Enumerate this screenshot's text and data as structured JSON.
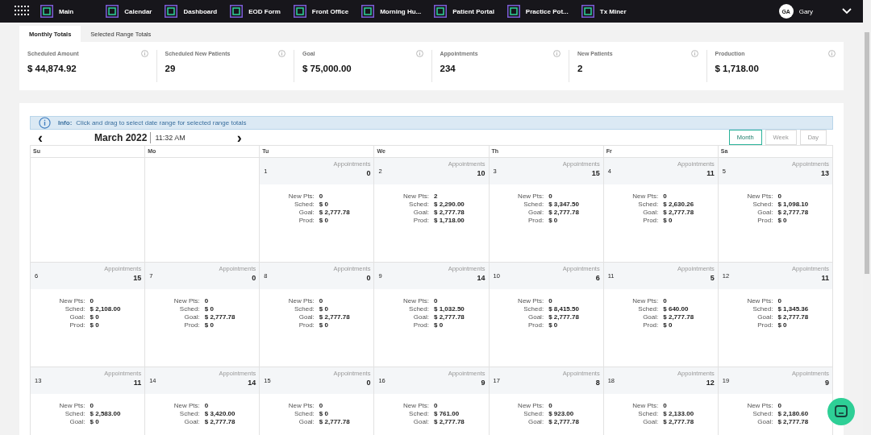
{
  "nav": {
    "items": [
      {
        "label": "Main"
      },
      {
        "label": "Calendar"
      },
      {
        "label": "Dashboard"
      },
      {
        "label": "EOD Form"
      },
      {
        "label": "Front Office"
      },
      {
        "label": "Morning Hu..."
      },
      {
        "label": "Patient Portal"
      },
      {
        "label": "Practice Pot..."
      },
      {
        "label": "Tx Miner"
      }
    ],
    "user": {
      "initials": "GA",
      "name": "Gary"
    }
  },
  "tabs": [
    {
      "label": "Monthly Totals",
      "selected": true
    },
    {
      "label": "Selected Range Totals",
      "selected": false
    }
  ],
  "stats": [
    {
      "label": "Scheduled Amount",
      "value": "$ 44,874.92"
    },
    {
      "label": "Scheduled New Patients",
      "value": "29"
    },
    {
      "label": "Goal",
      "value": "$ 75,000.00"
    },
    {
      "label": "Appointments",
      "value": "234"
    },
    {
      "label": "New Patients",
      "value": "2"
    },
    {
      "label": "Production",
      "value": "$ 1,718.00"
    }
  ],
  "info": {
    "label": "Info:",
    "text": "Click and drag to select date range for selected range totals"
  },
  "calendar": {
    "month": "March 2022",
    "time": "11:32 AM",
    "prev": "‹",
    "next": "›",
    "views": [
      {
        "label": "Month",
        "selected": true
      },
      {
        "label": "Week",
        "selected": false
      },
      {
        "label": "Day",
        "selected": false
      }
    ],
    "weekdays": [
      "Su",
      "Mo",
      "Tu",
      "We",
      "Th",
      "Fr",
      "Sa"
    ],
    "weeks": [
      [
        {
          "kind": "blank"
        },
        {
          "kind": "blank"
        },
        {
          "kind": "day",
          "day": "1",
          "appt_label": "Appointments",
          "appts": "0",
          "lines": [
            {
              "label": "New Pts:",
              "value": "0"
            },
            {
              "label": "Sched:",
              "value": "$ 0"
            },
            {
              "label": "Goal:",
              "value": "$ 2,777.78"
            },
            {
              "label": "Prod:",
              "value": "$ 0"
            }
          ]
        },
        {
          "kind": "day",
          "day": "2",
          "appt_label": "Appointments",
          "appts": "10",
          "lines": [
            {
              "label": "New Pts:",
              "value": "2"
            },
            {
              "label": "Sched:",
              "value": "$ 2,290.00"
            },
            {
              "label": "Goal:",
              "value": "$ 2,777.78"
            },
            {
              "label": "Prod:",
              "value": "$ 1,718.00"
            }
          ]
        },
        {
          "kind": "day",
          "day": "3",
          "appt_label": "Appointments",
          "appts": "15",
          "lines": [
            {
              "label": "New Pts:",
              "value": "0"
            },
            {
              "label": "Sched:",
              "value": "$ 3,347.50"
            },
            {
              "label": "Goal:",
              "value": "$ 2,777.78"
            },
            {
              "label": "Prod:",
              "value": "$ 0"
            }
          ]
        },
        {
          "kind": "day",
          "day": "4",
          "appt_label": "Appointments",
          "appts": "11",
          "lines": [
            {
              "label": "New Pts:",
              "value": "0"
            },
            {
              "label": "Sched:",
              "value": "$ 2,630.26"
            },
            {
              "label": "Goal:",
              "value": "$ 2,777.78"
            },
            {
              "label": "Prod:",
              "value": "$ 0"
            }
          ]
        },
        {
          "kind": "day",
          "day": "5",
          "appt_label": "Appointments",
          "appts": "13",
          "lines": [
            {
              "label": "New Pts:",
              "value": "0"
            },
            {
              "label": "Sched:",
              "value": "$ 1,098.10"
            },
            {
              "label": "Goal:",
              "value": "$ 2,777.78"
            },
            {
              "label": "Prod:",
              "value": "$ 0"
            }
          ]
        }
      ],
      [
        {
          "kind": "day",
          "day": "6",
          "appt_label": "Appointments",
          "appts": "15",
          "lines": [
            {
              "label": "New Pts:",
              "value": "0"
            },
            {
              "label": "Sched:",
              "value": "$ 2,108.00"
            },
            {
              "label": "Goal:",
              "value": "$ 0"
            },
            {
              "label": "Prod:",
              "value": "$ 0"
            }
          ]
        },
        {
          "kind": "day",
          "day": "7",
          "appt_label": "Appointments",
          "appts": "0",
          "lines": [
            {
              "label": "New Pts:",
              "value": "0"
            },
            {
              "label": "Sched:",
              "value": "$ 0"
            },
            {
              "label": "Goal:",
              "value": "$ 2,777.78"
            },
            {
              "label": "Prod:",
              "value": "$ 0"
            }
          ]
        },
        {
          "kind": "day",
          "day": "8",
          "appt_label": "Appointments",
          "appts": "0",
          "lines": [
            {
              "label": "New Pts:",
              "value": "0"
            },
            {
              "label": "Sched:",
              "value": "$ 0"
            },
            {
              "label": "Goal:",
              "value": "$ 2,777.78"
            },
            {
              "label": "Prod:",
              "value": "$ 0"
            }
          ]
        },
        {
          "kind": "day",
          "day": "9",
          "appt_label": "Appointments",
          "appts": "14",
          "lines": [
            {
              "label": "New Pts:",
              "value": "0"
            },
            {
              "label": "Sched:",
              "value": "$ 1,032.50"
            },
            {
              "label": "Goal:",
              "value": "$ 2,777.78"
            },
            {
              "label": "Prod:",
              "value": "$ 0"
            }
          ]
        },
        {
          "kind": "day",
          "day": "10",
          "appt_label": "Appointments",
          "appts": "6",
          "lines": [
            {
              "label": "New Pts:",
              "value": "0"
            },
            {
              "label": "Sched:",
              "value": "$ 8,415.50"
            },
            {
              "label": "Goal:",
              "value": "$ 2,777.78"
            },
            {
              "label": "Prod:",
              "value": "$ 0"
            }
          ]
        },
        {
          "kind": "day",
          "day": "11",
          "appt_label": "Appointments",
          "appts": "5",
          "lines": [
            {
              "label": "New Pts:",
              "value": "0"
            },
            {
              "label": "Sched:",
              "value": "$ 640.00"
            },
            {
              "label": "Goal:",
              "value": "$ 2,777.78"
            },
            {
              "label": "Prod:",
              "value": "$ 0"
            }
          ]
        },
        {
          "kind": "day",
          "day": "12",
          "appt_label": "Appointments",
          "appts": "11",
          "lines": [
            {
              "label": "New Pts:",
              "value": "0"
            },
            {
              "label": "Sched:",
              "value": "$ 1,345.36"
            },
            {
              "label": "Goal:",
              "value": "$ 2,777.78"
            },
            {
              "label": "Prod:",
              "value": "$ 0"
            }
          ]
        }
      ],
      [
        {
          "kind": "day",
          "day": "13",
          "appt_label": "Appointments",
          "appts": "11",
          "lines": [
            {
              "label": "New Pts:",
              "value": "0"
            },
            {
              "label": "Sched:",
              "value": "$ 2,583.00"
            },
            {
              "label": "Goal:",
              "value": "$ 0"
            }
          ]
        },
        {
          "kind": "day",
          "day": "14",
          "appt_label": "Appointments",
          "appts": "14",
          "lines": [
            {
              "label": "New Pts:",
              "value": "0"
            },
            {
              "label": "Sched:",
              "value": "$ 3,420.00"
            },
            {
              "label": "Goal:",
              "value": "$ 2,777.78"
            }
          ]
        },
        {
          "kind": "day",
          "day": "15",
          "appt_label": "Appointments",
          "appts": "0",
          "lines": [
            {
              "label": "New Pts:",
              "value": "0"
            },
            {
              "label": "Sched:",
              "value": "$ 0"
            },
            {
              "label": "Goal:",
              "value": "$ 2,777.78"
            }
          ]
        },
        {
          "kind": "day",
          "day": "16",
          "appt_label": "Appointments",
          "appts": "9",
          "lines": [
            {
              "label": "New Pts:",
              "value": "0"
            },
            {
              "label": "Sched:",
              "value": "$ 761.00"
            },
            {
              "label": "Goal:",
              "value": "$ 2,777.78"
            }
          ]
        },
        {
          "kind": "day",
          "day": "17",
          "appt_label": "Appointments",
          "appts": "8",
          "lines": [
            {
              "label": "New Pts:",
              "value": "0"
            },
            {
              "label": "Sched:",
              "value": "$ 923.00"
            },
            {
              "label": "Goal:",
              "value": "$ 2,777.78"
            }
          ]
        },
        {
          "kind": "day",
          "day": "18",
          "appt_label": "Appointments",
          "appts": "12",
          "lines": [
            {
              "label": "New Pts:",
              "value": "0"
            },
            {
              "label": "Sched:",
              "value": "$ 2,133.00"
            },
            {
              "label": "Goal:",
              "value": "$ 2,777.78"
            }
          ]
        },
        {
          "kind": "day",
          "day": "19",
          "appt_label": "Appointments",
          "appts": "9",
          "lines": [
            {
              "label": "New Pts:",
              "value": "0"
            },
            {
              "label": "Sched:",
              "value": "$ 2,180.60"
            },
            {
              "label": "Goal:",
              "value": "$ 2,777.78"
            }
          ]
        }
      ]
    ]
  }
}
